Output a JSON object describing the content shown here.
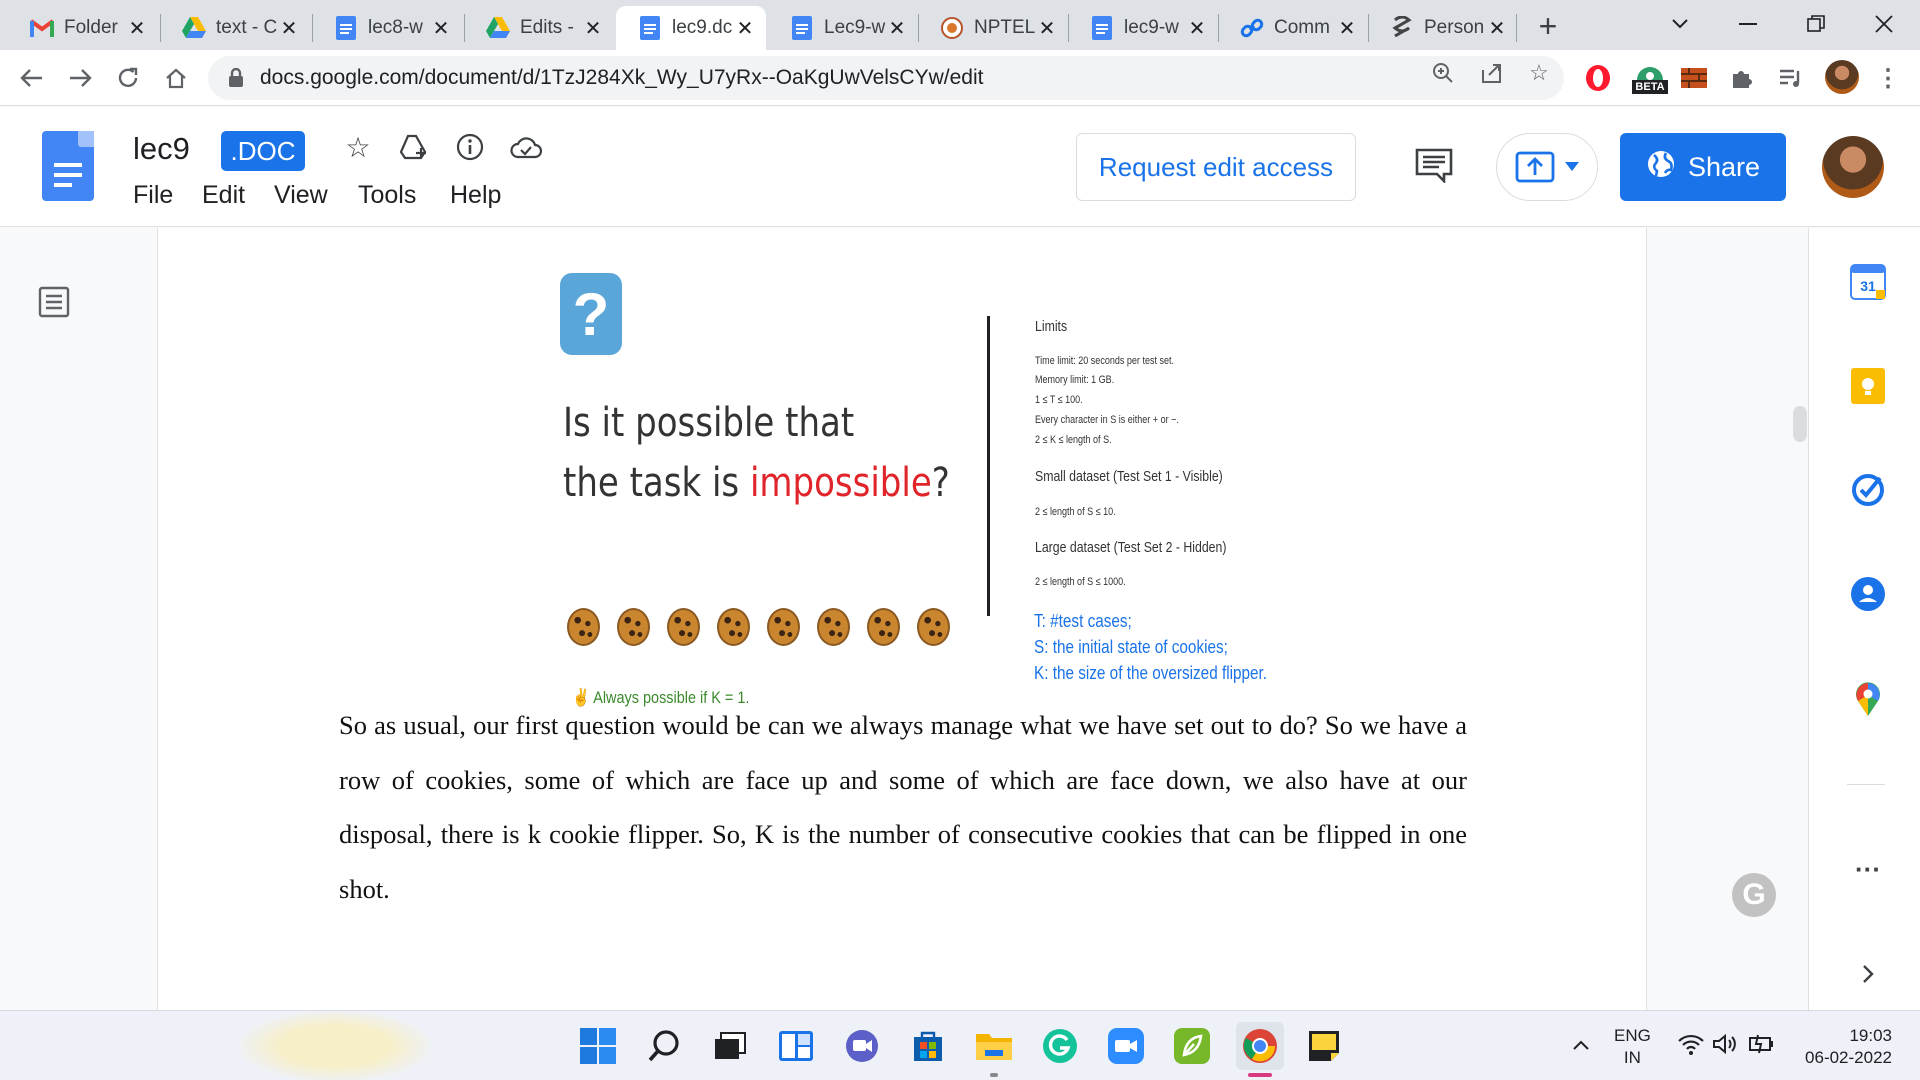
{
  "browser": {
    "tabs": [
      {
        "title": "Folder",
        "icon": "gmail-icon"
      },
      {
        "title": "text - C",
        "icon": "drive-icon"
      },
      {
        "title": "lec8-w",
        "icon": "docs-icon"
      },
      {
        "title": "Edits -",
        "icon": "drive-icon"
      },
      {
        "title": "lec9.dc",
        "icon": "docs-icon",
        "active": true
      },
      {
        "title": "Lec9-w",
        "icon": "docs-icon"
      },
      {
        "title": "NPTEL",
        "icon": "nptel-icon"
      },
      {
        "title": "lec9-w",
        "icon": "docs-icon"
      },
      {
        "title": "Comm",
        "icon": "link-icon"
      },
      {
        "title": "Person",
        "icon": "person-icon"
      }
    ],
    "url": "docs.google.com/document/d/1TzJ284Xk_Wy_U7yRx--OaKgUwVelsCYw/edit",
    "beta_label": "BETA"
  },
  "docs": {
    "title": "lec9",
    "badge": ".DOC",
    "menu": [
      "File",
      "Edit",
      "View",
      "Tools",
      "Help"
    ],
    "request_edit": "Request edit access",
    "share": "Share"
  },
  "slide": {
    "qmark": "?",
    "question_line1": "Is it possible that",
    "question_line2_prefix": "the task is ",
    "question_line2_highlight": "impossible",
    "question_line2_suffix": "?",
    "cookie_count": 8,
    "always_possible": "✌ Always possible if K = 1.",
    "limits_heading": "Limits",
    "limits_lines": [
      "Time limit: 20 seconds per test set.",
      "Memory limit: 1 GB.",
      "1 ≤ T ≤ 100.",
      "Every character in S is either + or −.",
      "2 ≤ K ≤ length of S."
    ],
    "small_heading": "Small dataset (Test Set 1 - Visible)",
    "small_line": "2 ≤ length of S ≤ 10.",
    "large_heading": "Large dataset (Test Set 2 - Hidden)",
    "large_line": "2 ≤ length of S ≤ 1000.",
    "legend": [
      "T: #test cases;",
      "S: the initial state of cookies;",
      "K: the size of the oversized flipper."
    ]
  },
  "body_text": "So as usual, our first question would be can we always manage what we have set out to do? So we have a row of cookies, some of which are face up and some of which are face down, we also have at our disposal, there is k cookie flipper. So, K is the number of consecutive cookies that can be flipped in one shot.",
  "side_panel": {
    "calendar_day": "31"
  },
  "grammarly_letter": "G",
  "taskbar": {
    "lang_line1": "ENG",
    "lang_line2": "IN",
    "time": "19:03",
    "date": "06-02-2022"
  },
  "colors": {
    "accent": "#1a73e8",
    "highlight_red": "#e0242a",
    "legend_blue": "#1a73e8",
    "green_note": "#3b8a2c"
  }
}
